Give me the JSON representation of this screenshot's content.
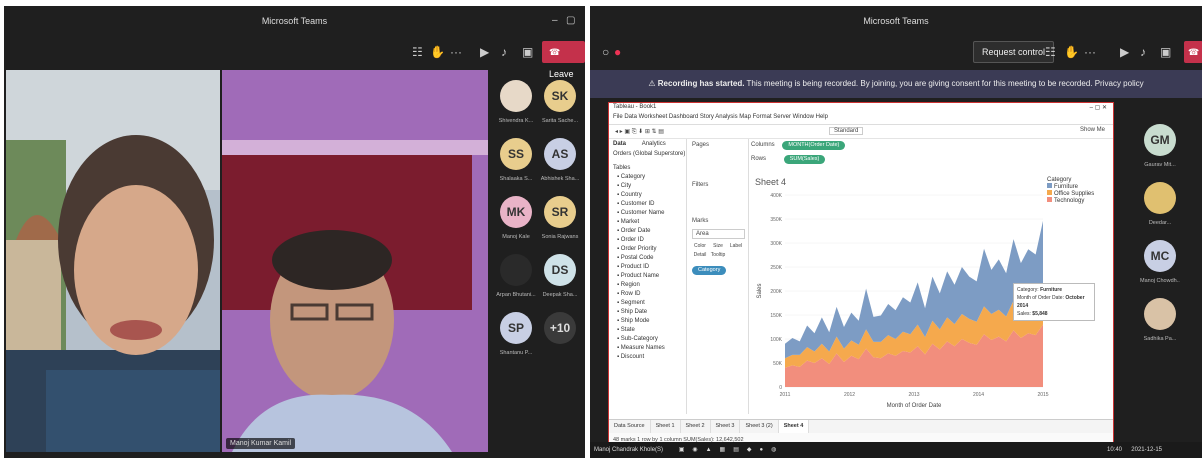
{
  "left_window": {
    "title": "Microsoft Teams",
    "leave_label": "Leave",
    "tiles": [
      {
        "initials": "",
        "name": "Shivendra K...",
        "color": "#e7d9c8"
      },
      {
        "initials": "SK",
        "name": "Sarita Sache...",
        "color": "#e8cd8d"
      },
      {
        "initials": "SS",
        "name": "Shalaaka S...",
        "color": "#e8cd8d"
      },
      {
        "initials": "AS",
        "name": "Abhishek Sha...",
        "color": "#c8cfe4"
      },
      {
        "initials": "MK",
        "name": "Manoj Kale",
        "color": "#e9b3c7"
      },
      {
        "initials": "SR",
        "name": "Sonia Rajwans",
        "color": "#e8cd8d"
      },
      {
        "initials": "",
        "name": "Arpan Bhutani...",
        "color": "#2a2a2a"
      },
      {
        "initials": "DS",
        "name": "Deepak Sha...",
        "color": "#cfe2e8"
      },
      {
        "initials": "SP",
        "name": "Shantanu P...",
        "color": "#c8cfe4"
      },
      {
        "initials": "+10",
        "name": "",
        "color": "#3a3a3a"
      }
    ],
    "video2_name": "Manoj Kumar Kamil"
  },
  "right_window": {
    "title": "Microsoft Teams",
    "request_control": "Request control",
    "banner_title": "Recording has started.",
    "banner_text": "This meeting is being recorded. By joining, you are giving consent for this meeting to be recorded. Privacy policy",
    "tiles": [
      {
        "initials": "GM",
        "name": "Gaurav Mit...",
        "color": "#c8dccf"
      },
      {
        "initials": "",
        "name": "Deedar...",
        "color": "#e0c070"
      },
      {
        "initials": "MC",
        "name": "Manoj Chowdh...",
        "color": "#c8cfe4"
      },
      {
        "initials": "",
        "name": "Sadhika Pa...",
        "color": "#d9c2a6"
      }
    ]
  },
  "tableau": {
    "window_title": "Tableau - Book1",
    "menu": "File  Data  Worksheet  Dashboard  Story  Analysis  Map  Format  Server  Window  Help",
    "show_me": "Show Me",
    "standard": "Standard",
    "data_tab": "Data",
    "analytics_tab": "Analytics",
    "datasource": "Orders (Global Superstore)",
    "tables_label": "Tables",
    "fields": [
      "Category",
      "City",
      "Country",
      "Customer ID",
      "Customer Name",
      "Market",
      "Order Date",
      "Order ID",
      "Order Priority",
      "Postal Code",
      "Product ID",
      "Product Name",
      "Region",
      "Row ID",
      "Segment",
      "Ship Date",
      "Ship Mode",
      "State",
      "Sub-Category",
      "Measure Names",
      "Discount"
    ],
    "pages_label": "Pages",
    "filters_label": "Filters",
    "marks_label": "Marks",
    "marks_type": "Area",
    "marks_buttons": [
      "Color",
      "Size",
      "Label",
      "Detail",
      "Tooltip"
    ],
    "marks_pill": "Category",
    "columns_label": "Columns",
    "rows_label": "Rows",
    "columns_pill": "MONTH(Order Date)",
    "rows_pill": "SUM(Sales)",
    "sheet_title": "Sheet 4",
    "legend_title": "Category",
    "legend_items": [
      "Furniture",
      "Office Supplies",
      "Technology"
    ],
    "tooltip": {
      "label1": "Category:",
      "value1": "Furniture",
      "label2": "Month of Order Date:",
      "value2": "October 2014",
      "label3": "Sales:",
      "value3": "$5,848"
    },
    "tabs": [
      "Data Source",
      "Sheet 1",
      "Sheet 2",
      "Sheet 3",
      "Sheet 3 (2)",
      "Sheet 4"
    ],
    "status": "48 marks    1 row by 1 column    SUM(Sales): 12,642,502"
  },
  "taskbar": {
    "search": "Manoj Chandrak Khole(S)",
    "time": "10:40",
    "date": "2021-12-15"
  },
  "chart_data": {
    "type": "area",
    "title": "Sheet 4",
    "xlabel": "Month of Order Date",
    "ylabel": "Sales",
    "x_ticks": [
      "2011",
      "2012",
      "2013",
      "2014",
      "2015"
    ],
    "y_ticks": [
      "0",
      "50K",
      "100K",
      "150K",
      "200K",
      "250K",
      "300K",
      "350K",
      "400K"
    ],
    "ylim": [
      0,
      400000
    ],
    "stacked": true,
    "series": [
      {
        "name": "Technology",
        "color": "#f28e7d",
        "values": [
          40000,
          45000,
          42000,
          55000,
          50000,
          60000,
          48000,
          70000,
          52000,
          65000,
          58000,
          80000,
          62000,
          60000,
          70000,
          65000,
          75000,
          72000,
          85000,
          68000,
          90000,
          78000,
          95000,
          85000,
          100000,
          92000,
          88000,
          110000,
          98000,
          105000,
          95000,
          118000,
          102000,
          112000,
          108000,
          130000
        ]
      },
      {
        "name": "Office Supplies",
        "color": "#f5a94d",
        "values": [
          20000,
          22000,
          25000,
          28000,
          24000,
          30000,
          26000,
          35000,
          28000,
          32000,
          30000,
          40000,
          32000,
          34000,
          38000,
          35000,
          40000,
          38000,
          45000,
          36000,
          48000,
          42000,
          50000,
          46000,
          52000,
          50000,
          48000,
          58000,
          54000,
          56000,
          52000,
          62000,
          56000,
          60000,
          58000,
          66000
        ]
      },
      {
        "name": "Furniture",
        "color": "#7d9cc4",
        "values": [
          30000,
          35000,
          28000,
          45000,
          38000,
          55000,
          40000,
          62000,
          45000,
          58000,
          50000,
          85000,
          52000,
          55000,
          65000,
          60000,
          72000,
          66000,
          88000,
          60000,
          92000,
          75000,
          96000,
          82000,
          98000,
          88000,
          84000,
          120000,
          92000,
          105000,
          90000,
          128000,
          100000,
          115000,
          110000,
          150000
        ]
      }
    ],
    "legend": "right"
  }
}
